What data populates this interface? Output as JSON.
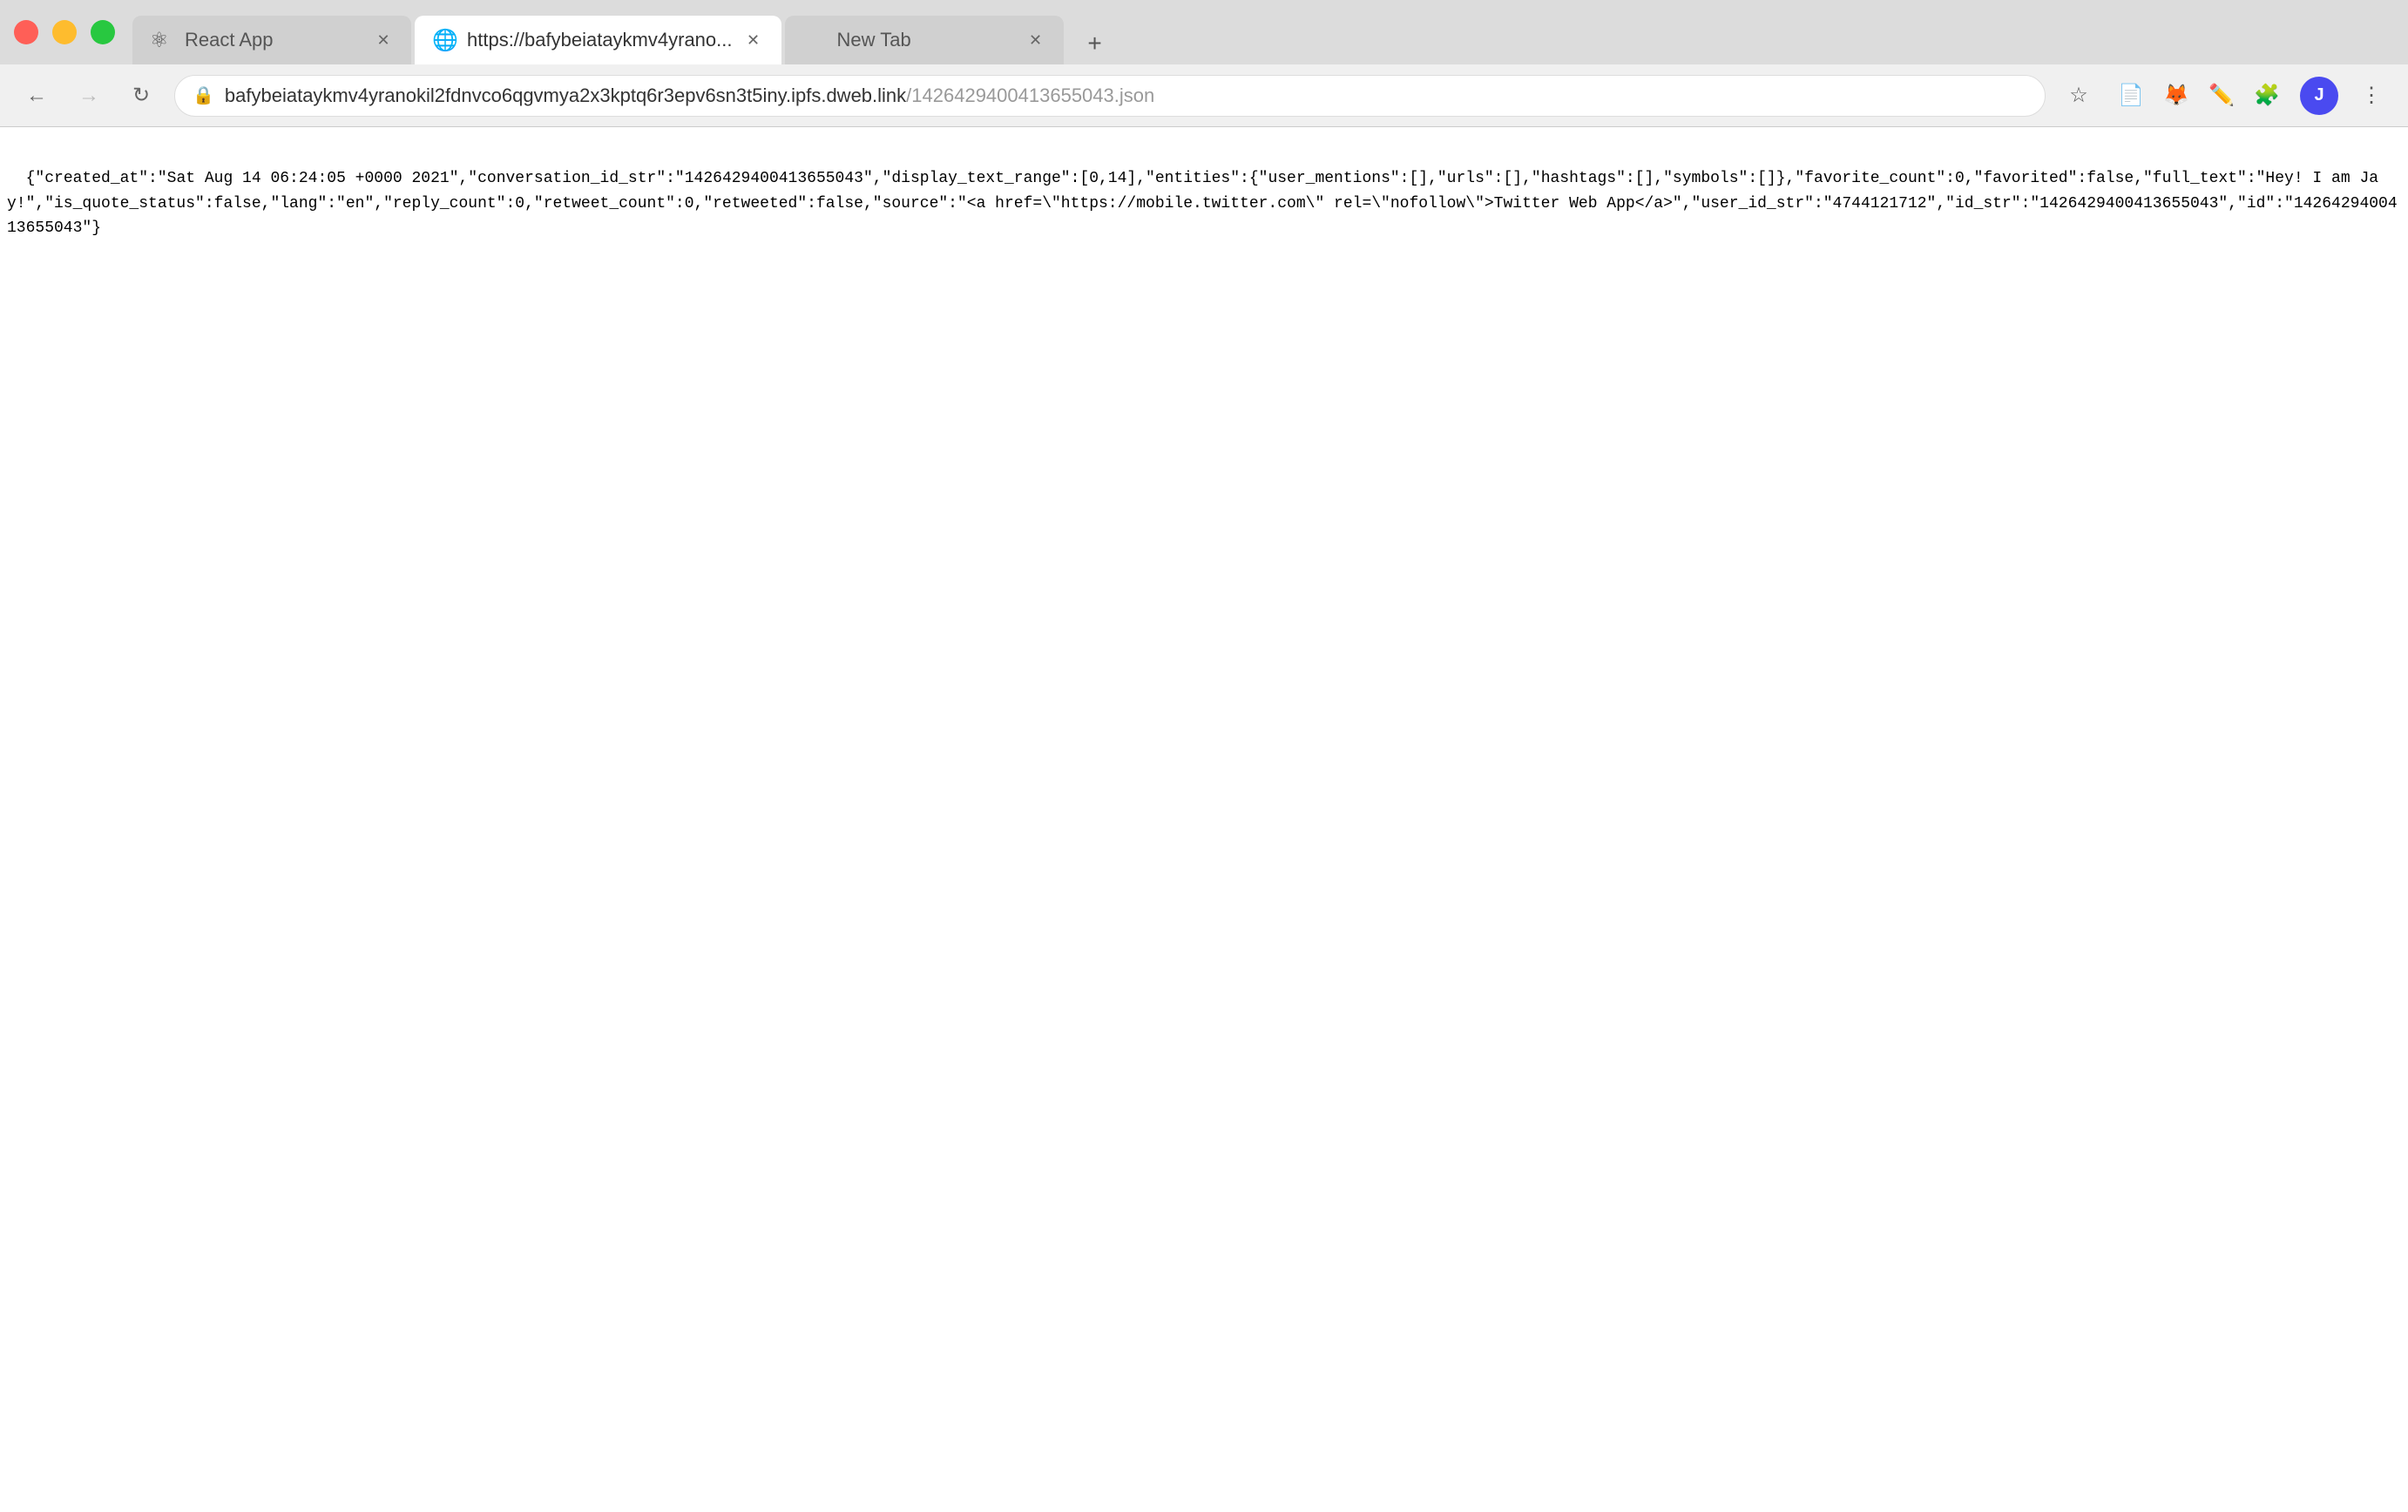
{
  "browser": {
    "tabs": [
      {
        "id": "tab-react-app",
        "label": "React App",
        "favicon": "⚛",
        "active": false,
        "closeable": true
      },
      {
        "id": "tab-ipfs",
        "label": "https://bafybeiataykmv4yrano...",
        "favicon": "🌐",
        "active": true,
        "closeable": true
      },
      {
        "id": "tab-new",
        "label": "New Tab",
        "favicon": "⬜",
        "active": false,
        "closeable": true
      }
    ],
    "new_tab_label": "+",
    "address_bar": {
      "full_url": "bafybeiataykmv4yranokil2fdnvco6qgvmya2x3kptq6r3epv6sn3t5iny.ipfs.dweb.link/1426429400413655043.json",
      "url_base": "bafybeiataykmv4yranokil2fdnvco6qgvmya2x3kptq6r3epv6sn3t5iny.ipfs.dweb.link",
      "url_path": "/1426429400413655043.json"
    },
    "nav": {
      "back_disabled": false,
      "forward_disabled": true
    }
  },
  "page": {
    "json_content": "{\"created_at\":\"Sat Aug 14 06:24:05 +0000 2021\",\"conversation_id_str\":\"1426429400413655043\",\"display_text_range\":[0,14],\"entities\":{\"user_mentions\":[],\"urls\":[],\"hashtags\":[],\"symbols\":[]},\"favorite_count\":0,\"favorited\":false,\"full_text\":\"Hey! I am Jay!\",\"is_quote_status\":false,\"lang\":\"en\",\"reply_count\":0,\"retweet_count\":0,\"retweeted\":false,\"source\":\"<a href=\\\"https://mobile.twitter.com\\\" rel=\\\"nofollow\\\">Twitter Web App</a>\",\"user_id_str\":\"4744121712\",\"id_str\":\"1426429400413655043\",\"id\":\"1426429400413655043\"}"
  },
  "icons": {
    "back": "←",
    "forward": "→",
    "reload": "↻",
    "lock": "🔒",
    "star": "☆",
    "extensions": "🧩",
    "profile": "J",
    "menu": "⋮",
    "close": "✕"
  }
}
